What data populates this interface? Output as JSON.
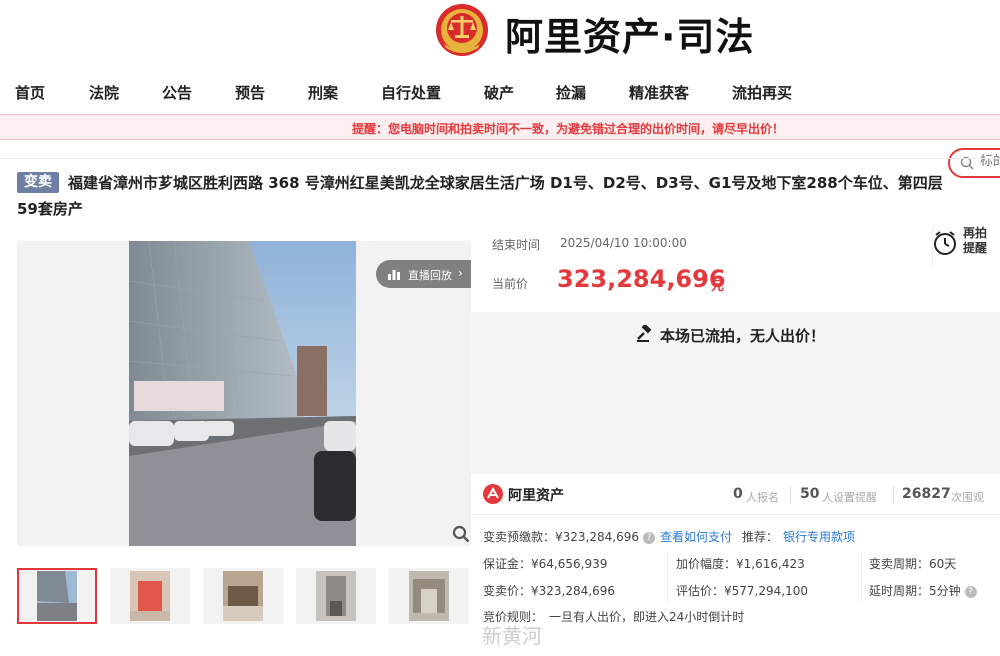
{
  "header": {
    "logo_text": "阿里资产·司法"
  },
  "nav": {
    "items": [
      "首页",
      "法院",
      "公告",
      "预告",
      "刑案",
      "自行处置",
      "破产",
      "捡漏",
      "精准获客",
      "流拍再买"
    ],
    "search_placeholder": "标的"
  },
  "notice": "提醒：您电脑时间和拍卖时间不一致，为避免错过合理的出价时间，请尽早出价！",
  "item": {
    "badge": "变卖",
    "title_line1": "福建省漳州市芗城区胜利西路 368 号漳州红星美凯龙全球家居生活广场 D1号、D2号、D3号、G1号及地下室288个车位、第四层",
    "title_line2": "59套房产"
  },
  "gallery": {
    "live_replay": "直播回放"
  },
  "auction": {
    "end_label": "结束时间",
    "end_value": "2025/04/10 10:00:00",
    "price_label": "当前价",
    "price_value": "323,284,696",
    "price_unit": "元",
    "remind_label": "再拍提醒",
    "status_text": "本场已流拍，无人出价！"
  },
  "stats": {
    "platform": "阿里资产",
    "signup_count": "0",
    "signup_label": "人报名",
    "reminder_count": "50",
    "reminder_label": "人设置提醒",
    "views_count": "26827",
    "views_label": "次围观"
  },
  "details": {
    "prepay_label": "变卖预缴款：",
    "prepay_value": "¥323,284,696",
    "how_to_pay": "查看如何支付",
    "recommend_label": "推荐：",
    "bank_link": "银行专用款项",
    "deposit_label": "保证金：",
    "deposit_value": "¥64,656,939",
    "increment_label": "加价幅度：",
    "increment_value": "¥1,616,423",
    "period_label": "变卖周期：",
    "period_value": "60天",
    "sale_price_label": "变卖价：",
    "sale_price_value": "¥323,284,696",
    "appraisal_label": "评估价：",
    "appraisal_value": "¥577,294,100",
    "delay_label": "延时周期：",
    "delay_value": "5分钟",
    "rule_label": "竞价规则：",
    "rule_value": "一旦有人出价，即进入24小时倒计时"
  },
  "watermark": "新黄河",
  "colors": {
    "accent": "#e4393c",
    "badge": "#6f7fa3",
    "link": "#2a7ad6"
  }
}
